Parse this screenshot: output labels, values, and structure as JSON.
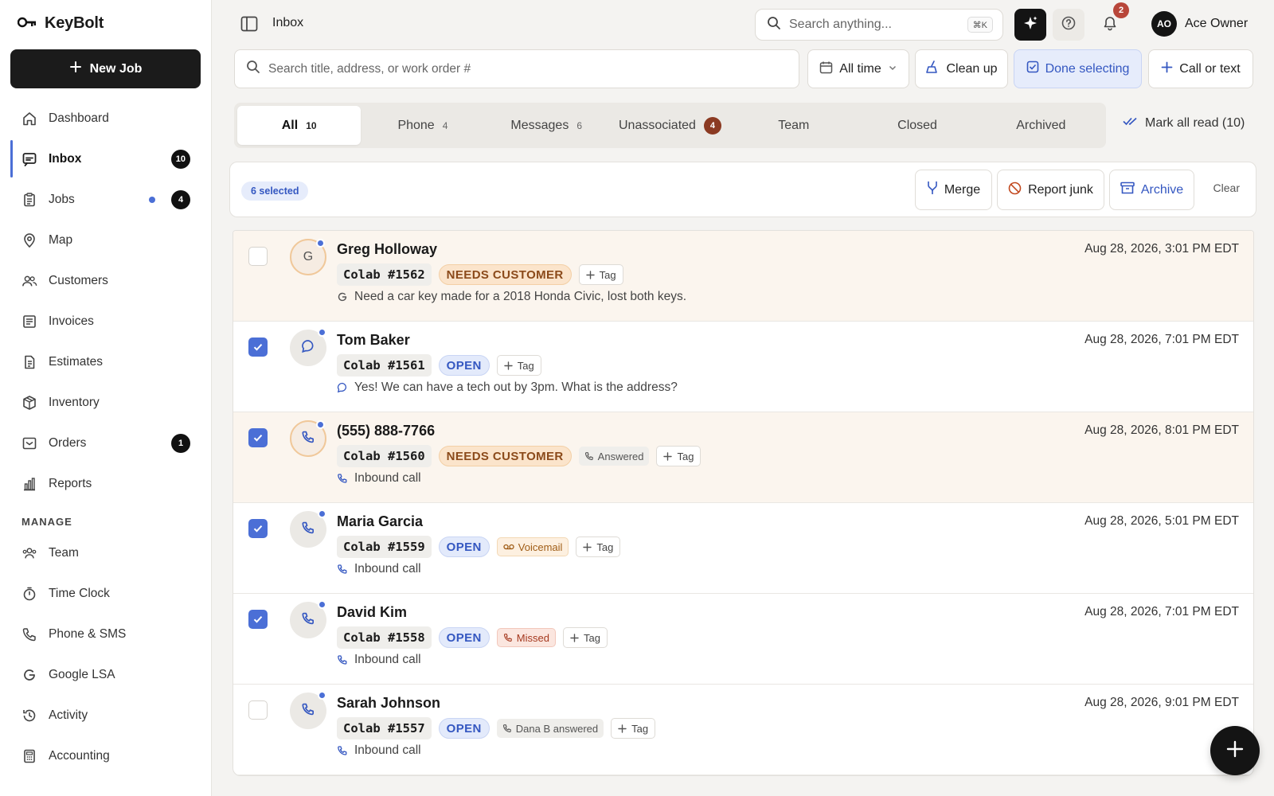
{
  "app": {
    "name": "KeyBolt",
    "new_job_label": "New Job"
  },
  "sidebar": {
    "items": [
      {
        "label": "Dashboard",
        "icon": "home-icon"
      },
      {
        "label": "Inbox",
        "icon": "inbox-icon",
        "count": "10",
        "active": true
      },
      {
        "label": "Jobs",
        "icon": "clipboard-icon",
        "count": "4",
        "dot": true
      },
      {
        "label": "Map",
        "icon": "map-pin-icon"
      },
      {
        "label": "Customers",
        "icon": "users-icon"
      },
      {
        "label": "Invoices",
        "icon": "invoice-icon"
      },
      {
        "label": "Estimates",
        "icon": "document-icon"
      },
      {
        "label": "Inventory",
        "icon": "box-icon"
      },
      {
        "label": "Orders",
        "icon": "orders-icon",
        "count": "1"
      },
      {
        "label": "Reports",
        "icon": "bar-chart-icon"
      }
    ],
    "manage_label": "MANAGE",
    "manage_items": [
      {
        "label": "Team",
        "icon": "team-icon"
      },
      {
        "label": "Time Clock",
        "icon": "stopwatch-icon"
      },
      {
        "label": "Phone & SMS",
        "icon": "phone-icon"
      },
      {
        "label": "Google LSA",
        "icon": "google-icon"
      },
      {
        "label": "Activity",
        "icon": "history-icon"
      },
      {
        "label": "Accounting",
        "icon": "calculator-icon"
      }
    ]
  },
  "topbar": {
    "breadcrumb": "Inbox",
    "search_placeholder": "Search anything...",
    "shortcut": "⌘K",
    "notification_count": "2",
    "user_initials": "AO",
    "user_name": "Ace Owner"
  },
  "filters": {
    "search_placeholder": "Search title, address, or work order #",
    "time_label": "All time",
    "cleanup_label": "Clean up",
    "done_selecting_label": "Done selecting",
    "call_or_text_label": "Call or text"
  },
  "tabs": [
    {
      "label": "All",
      "count": "10",
      "active": true
    },
    {
      "label": "Phone",
      "count": "4"
    },
    {
      "label": "Messages",
      "count": "6"
    },
    {
      "label": "Unassociated",
      "count": "4",
      "badge": true
    },
    {
      "label": "Team"
    },
    {
      "label": "Closed"
    },
    {
      "label": "Archived"
    }
  ],
  "mark_all_read": "Mark all read (10)",
  "selection": {
    "count_label": "6 selected",
    "merge": "Merge",
    "report_junk": "Report junk",
    "archive": "Archive",
    "clear": "Clear"
  },
  "conversations": [
    {
      "name": "Greg Holloway",
      "work_order": "Colab #1562",
      "status": "NEEDS CUSTOMER",
      "status_kind": "needs",
      "call_chip": "",
      "call_kind": "",
      "tag": "Tag",
      "preview": "Need a car key made for a 2018 Honda Civic, lost both keys.",
      "preview_icon": "google-icon",
      "time": "Aug 28, 2026, 3:01 PM EDT",
      "checked": false,
      "avatar": "G",
      "avatar_icon": "",
      "highlight": true
    },
    {
      "name": "Tom Baker",
      "work_order": "Colab #1561",
      "status": "OPEN",
      "status_kind": "open",
      "call_chip": "",
      "call_kind": "",
      "tag": "Tag",
      "preview": "Yes! We can have a tech out by 3pm. What is the address?",
      "preview_icon": "message-icon",
      "time": "Aug 28, 2026, 7:01 PM EDT",
      "checked": true,
      "avatar": "",
      "avatar_icon": "message-icon",
      "highlight": false
    },
    {
      "name": "(555) 888-7766",
      "work_order": "Colab #1560",
      "status": "NEEDS CUSTOMER",
      "status_kind": "needs",
      "call_chip": "Answered",
      "call_kind": "answered",
      "tag": "Tag",
      "preview": "Inbound call",
      "preview_icon": "phone-icon",
      "time": "Aug 28, 2026, 8:01 PM EDT",
      "checked": true,
      "avatar": "",
      "avatar_icon": "phone-icon",
      "highlight": true
    },
    {
      "name": "Maria Garcia",
      "work_order": "Colab #1559",
      "status": "OPEN",
      "status_kind": "open",
      "call_chip": "Voicemail",
      "call_kind": "voicemail",
      "tag": "Tag",
      "preview": "Inbound call",
      "preview_icon": "phone-icon",
      "time": "Aug 28, 2026, 5:01 PM EDT",
      "checked": true,
      "avatar": "",
      "avatar_icon": "phone-icon",
      "highlight": false
    },
    {
      "name": "David Kim",
      "work_order": "Colab #1558",
      "status": "OPEN",
      "status_kind": "open",
      "call_chip": "Missed",
      "call_kind": "missed",
      "tag": "Tag",
      "preview": "Inbound call",
      "preview_icon": "phone-icon",
      "time": "Aug 28, 2026, 7:01 PM EDT",
      "checked": true,
      "avatar": "",
      "avatar_icon": "phone-icon",
      "highlight": false
    },
    {
      "name": "Sarah Johnson",
      "work_order": "Colab #1557",
      "status": "OPEN",
      "status_kind": "open",
      "call_chip": "Dana B answered",
      "call_kind": "dana",
      "tag": "Tag",
      "preview": "Inbound call",
      "preview_icon": "phone-icon",
      "time": "Aug 28, 2026, 9:01 PM EDT",
      "checked": false,
      "avatar": "",
      "avatar_icon": "phone-icon",
      "highlight": false
    }
  ],
  "colors": {
    "accent": "#4b6fd6",
    "brand_dark": "#141414",
    "highlight_row": "#fbf5ee"
  }
}
